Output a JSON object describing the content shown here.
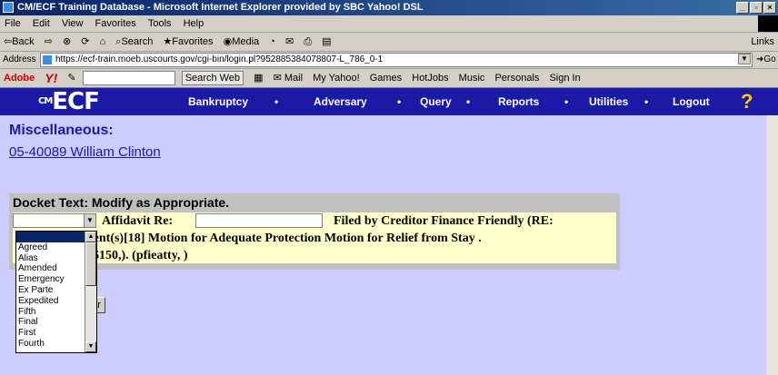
{
  "window": {
    "title": "CM/ECF Training Database - Microsoft Internet Explorer provided by SBC Yahoo! DSL",
    "minimize": "_",
    "maximize": "▫",
    "close": "×"
  },
  "menu": [
    "File",
    "Edit",
    "View",
    "Favorites",
    "Tools",
    "Help"
  ],
  "toolbar": {
    "back": "⇦Back",
    "forward": "⇨",
    "search": "Search",
    "favorites": "Favorites",
    "media": "Media",
    "links": "Links"
  },
  "address": {
    "label": "Address",
    "url": "https://ecf-train.moeb.uscourts.gov/cgi-bin/login.pl?952885384078807-L_786_0-1",
    "go": "Go"
  },
  "yahoo": {
    "adobe": "Adobe",
    "logo": "Y!",
    "search_web": "Search Web",
    "mail": "Mail",
    "my_yahoo": "My Yahoo!",
    "games": "Games",
    "hotjobs": "HotJobs",
    "music": "Music",
    "personals": "Personals",
    "sign_in": "Sign In"
  },
  "nav": {
    "logo": "ECF",
    "logo_prefix": "CM",
    "items": [
      "Bankruptcy",
      "Adversary",
      "Query",
      "Reports",
      "Utilities",
      "Logout"
    ],
    "separator": "•",
    "help": "?"
  },
  "page": {
    "heading": "Miscellaneous:",
    "case_link": "05-40089 William Clinton",
    "docket_header": "Docket Text: Modify as Appropriate.",
    "affidavit_label": "Affidavit Re:",
    "filed_by": "Filed by Creditor Finance Friendly (RE:",
    "line2": "ment(s)[18] Motion for Adequate Protection Motion for Relief from Stay .",
    "line3": "$150,). (pfieatty, )",
    "clear_button": "ear",
    "dropdown_options": [
      "",
      "Agreed",
      "Alias",
      "Amended",
      "Emergency",
      "Ex Parte",
      "Expedited",
      "Fifth",
      "Final",
      "First",
      "Fourth"
    ]
  }
}
